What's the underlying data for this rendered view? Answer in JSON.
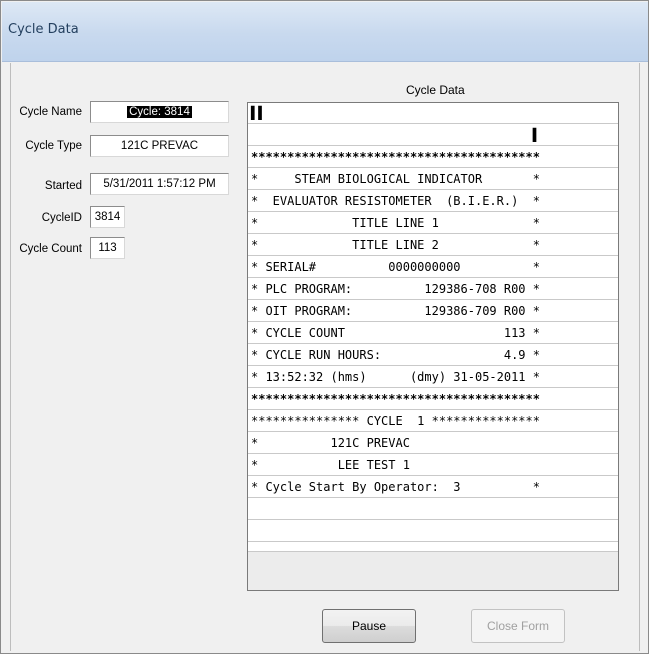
{
  "window": {
    "title": "Cycle Data"
  },
  "fields": {
    "cycle_name_label": "Cycle Name",
    "cycle_name_value": "Cycle: 3814",
    "cycle_type_label": "Cycle Type",
    "cycle_type_value": "121C PREVAC",
    "started_label": "Started",
    "started_value": "5/31/2011 1:57:12 PM",
    "cycle_id_label": "CycleID",
    "cycle_id_value": "3814",
    "cycle_count_label": "Cycle Count",
    "cycle_count_value": "113"
  },
  "printout": {
    "caption": "Cycle Data",
    "lines": [
      "▌▌",
      "                                       ▌",
      "****************************************",
      "*     STEAM BIOLOGICAL INDICATOR       *",
      "*  EVALUATOR RESISTOMETER  (B.I.E.R.)  *",
      "*             TITLE LINE 1             *",
      "*             TITLE LINE 2             *",
      "* SERIAL#          0000000000          *",
      "* PLC PROGRAM:          129386-708 R00 *",
      "* OIT PROGRAM:          129386-709 R00 *",
      "* CYCLE COUNT                      113 *",
      "* CYCLE RUN HOURS:                 4.9 *",
      "* 13:52:32 (hms)      (dmy) 31-05-2011 *",
      "****************************************",
      "*************** CYCLE  1 ***************",
      "*          121C PREVAC",
      "*           LEE TEST 1",
      "* Cycle Start By Operator:  3          *",
      "",
      ""
    ]
  },
  "buttons": {
    "pause_label": "Pause",
    "close_label": "Close Form"
  }
}
